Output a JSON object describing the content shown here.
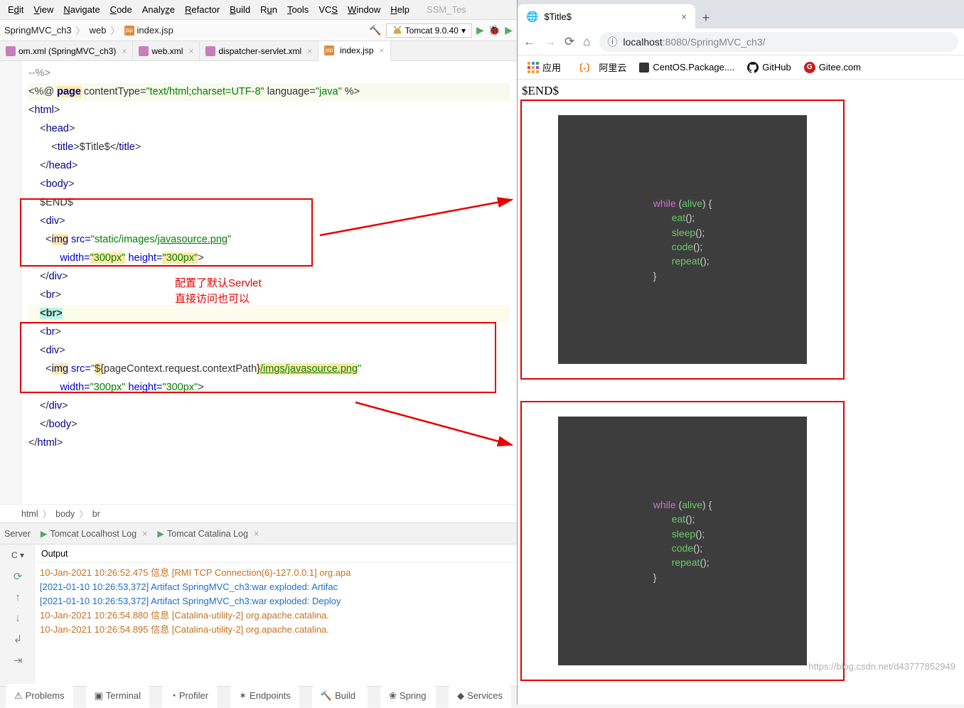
{
  "ide": {
    "menu": {
      "edit": "Edit",
      "view": "View",
      "navigate": "Navigate",
      "code": "Code",
      "analyze": "Analyze",
      "refactor": "Refactor",
      "build": "Build",
      "run": "Run",
      "tools": "Tools",
      "vcs": "VCS",
      "window": "Window",
      "help": "Help",
      "greyed": "SSM_Tes"
    },
    "nav": {
      "crumb1": "SpringMVC_ch3",
      "crumb2": "web",
      "crumb3": "index.jsp",
      "runconfig": "Tomcat 9.0.40"
    },
    "tabs": {
      "t1": "om.xml (SpringMVC_ch3)",
      "t2": "web.xml",
      "t3": "dispatcher-servlet.xml",
      "t4": "index.jsp"
    },
    "code": {
      "l1a": "--%>",
      "l2a": "<%@ ",
      "l2page": "page",
      "l2b": " contentType=",
      "l2str1": "\"text/html;charset=UTF-8\"",
      "l2c": " language=",
      "l2str2": "\"java\"",
      "l2d": " %>",
      "l3": "<",
      "l3tag": "html",
      "l3b": ">",
      "l4a": "    <",
      "l4tag": "head",
      "l4b": ">",
      "l5a": "        <",
      "l5tag": "title",
      "l5b": ">$Title$</",
      "l5c": ">",
      "l6a": "    </",
      "l6tag": "head",
      "l6b": ">",
      "l7a": "    <",
      "l7tag": "body",
      "l7b": ">",
      "l8": "    $END$",
      "l9a": "    <",
      "l9tag": "div",
      "l9b": ">",
      "l10a": "      <",
      "l10tag": "img",
      "l10b": " src=",
      "l10str": "\"static/images/",
      "l10link": "javasource.png",
      "l10d": "\"",
      "l11a": "           width=",
      "l11s1": "\"300px\"",
      "l11b": " height=",
      "l11s2": "\"300px\"",
      "l11c": ">",
      "l12a": "    </",
      "l12tag": "div",
      "l12b": ">",
      "l13a": "    <",
      "l13tag": "br",
      "l13b": ">",
      "l14a": "    ",
      "l14br": "<br>",
      "l15a": "    <",
      "l15tag": "br",
      "l15b": ">",
      "l16a": "    <",
      "l16tag": "div",
      "l16b": ">",
      "l17a": "      <",
      "l17tag": "img",
      "l17b": " src=",
      "l17q": "\"",
      "l17el1": "${",
      "l17el2": "pageContext.request.contextPath",
      "l17el3": "}",
      "l17link": "/imgs/javasource.png",
      "l17d": "\"",
      "l18a": "           width=",
      "l18s1": "\"300px\"",
      "l18b": " height=",
      "l18s2": "\"300px\"",
      "l18c": ">",
      "l19a": "    </",
      "l19tag": "div",
      "l19b": ">",
      "l20a": "    </",
      "l20tag": "body",
      "l20b": ">",
      "l21a": "</",
      "l21tag": "html",
      "l21b": ">"
    },
    "anno": {
      "line1": "配置了默认Servlet",
      "line2": "直接访问也可以"
    },
    "crumbs": {
      "c1": "html",
      "c2": "body",
      "c3": "br"
    },
    "termtabs": {
      "t1": "Server",
      "t2": "Tomcat Localhost Log",
      "t3": "Tomcat Catalina Log"
    },
    "outhdr": "Output",
    "outside": "C",
    "outlines": {
      "o1": "10-Jan-2021 10:26:52.475 信息 [RMI TCP Connection(6)-127.0.0.1] org.apa",
      "o2": "[2021-01-10 10:26:53,372] Artifact SpringMVC_ch3:war exploded: Artifac",
      "o3": "[2021-01-10 10:26:53,372] Artifact SpringMVC_ch3:war exploded: Deploy ",
      "o4": "10-Jan-2021 10:26:54.880 信息 [Catalina-utility-2] org.apache.catalina.",
      "o5": "10-Jan-2021 10:26:54.895 信息 [Catalina-utility-2] org.apache.catalina."
    },
    "bottom": {
      "b1": "Problems",
      "b2": "Terminal",
      "b3": "Profiler",
      "b4": "Endpoints",
      "b5": "Build",
      "b6": "Spring",
      "b7": "Services"
    }
  },
  "browser": {
    "tab": {
      "title": "$Title$"
    },
    "url": {
      "host": "localhost",
      "port": ":8080",
      "path": "/SpringMVC_ch3/"
    },
    "bm": {
      "apps": "应用",
      "aliyun": "阿里云",
      "centos": "CentOS.Package....",
      "github": "GitHub",
      "gitee": "Gitee.com"
    },
    "page": {
      "end": "$END$"
    },
    "codeimg": {
      "while": "while",
      "alive": "alive",
      "ob": "{",
      "cb": "}",
      "eat": "eat",
      "sleep": "sleep",
      "code": "code",
      "repeat": "repeat",
      "pp": "();"
    },
    "wmark2": "https://blog.csdn.net/d43777852949"
  }
}
